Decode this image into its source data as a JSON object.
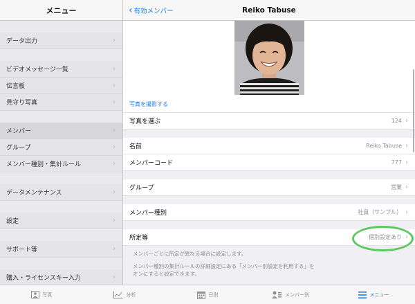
{
  "sidebar": {
    "title": "メニュー",
    "groups": [
      [
        {
          "label": "データ出力"
        }
      ],
      [
        {
          "label": "ビデオメッセージ一覧"
        },
        {
          "label": "伝言板"
        },
        {
          "label": "見守り写真"
        }
      ],
      [
        {
          "label": "メンバー"
        },
        {
          "label": "グループ"
        },
        {
          "label": "メンバー種別・集計ルール"
        }
      ],
      [
        {
          "label": "データメンテナンス"
        }
      ],
      [
        {
          "label": "設定"
        }
      ],
      [
        {
          "label": "サポート等"
        }
      ],
      [
        {
          "label": "購入・ライセンスキー入力"
        }
      ]
    ]
  },
  "nav": {
    "back_label": "有効メンバー",
    "title": "Reiko Tabuse"
  },
  "photo": {
    "take_photo_label": "写真を撮影する"
  },
  "rows": {
    "choose_photo": {
      "label": "写真を選ぶ",
      "value": "124"
    },
    "name": {
      "label": "名前",
      "value": "Reiko Tabuse"
    },
    "member_code": {
      "label": "メンバーコード",
      "value": "777"
    },
    "group": {
      "label": "グループ",
      "value": "営業"
    },
    "member_type": {
      "label": "メンバー種別",
      "value": "社員（サンプル）"
    },
    "workplace": {
      "label": "所定等",
      "value": "個別設定あり"
    }
  },
  "notes": {
    "line1": "メンバーごとに所定が異なる場合に設定します。",
    "line2": "メンバー種別の集計ルールの詳細設定にある「メンバー別設定を利用する」を",
    "line3": "オンにすると設定できます。"
  },
  "tabbar": {
    "tabs": [
      {
        "label": "写真",
        "icon": "photo-icon"
      },
      {
        "label": "分析",
        "icon": "chart-icon"
      },
      {
        "label": "日別",
        "icon": "calendar-icon"
      },
      {
        "label": "メンバー別",
        "icon": "member-icon"
      },
      {
        "label": "メニュー",
        "icon": "menu-icon"
      }
    ],
    "active_index": 4
  },
  "colors": {
    "accent": "#1a7cf0",
    "highlight": "#5ec85e"
  }
}
